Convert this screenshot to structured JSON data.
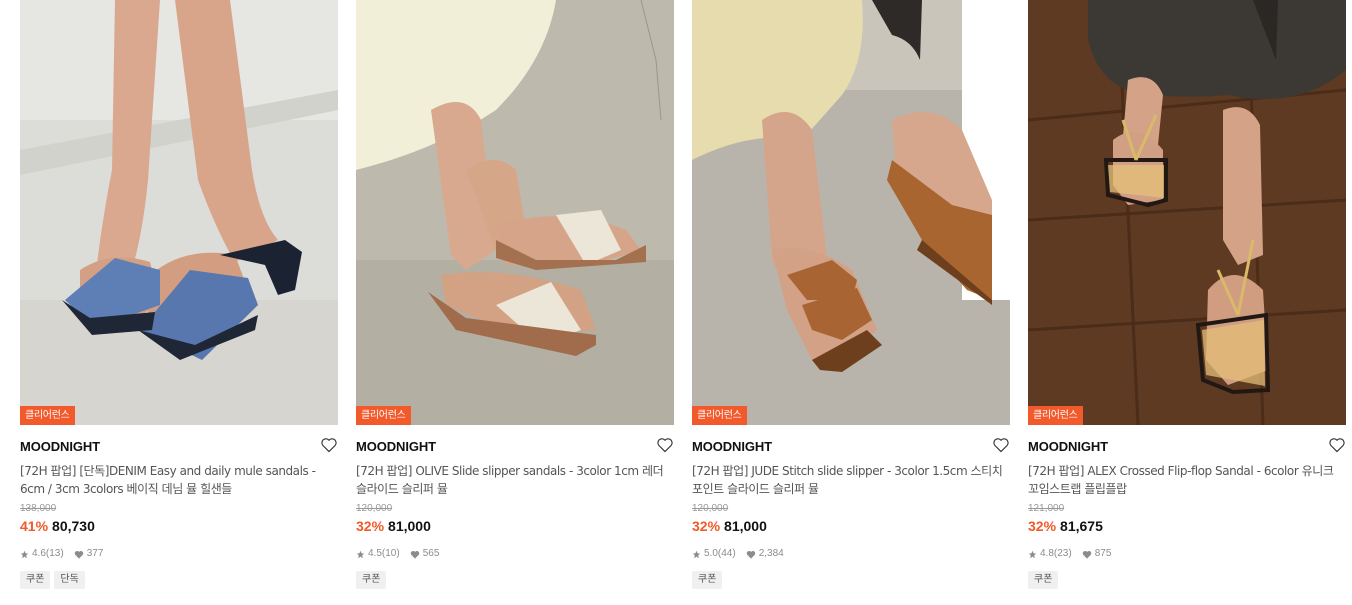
{
  "products": [
    {
      "badge": "클리어런스",
      "brand": "MOODNIGHT",
      "title": "[72H 팝업] [단독]DENIM Easy and daily mule sandals - 6cm / 3cm 3colors 베이직 데님 뮬 힐샌들",
      "original_price": "138,000",
      "discount": "41%",
      "price": "80,730",
      "rating": "4.6",
      "reviews": "(13)",
      "likes": "377",
      "tags": [
        "쿠폰",
        "단독"
      ],
      "image_desc": "denim-mule-heel-photo"
    },
    {
      "badge": "클리어런스",
      "brand": "MOODNIGHT",
      "title": "[72H 팝업] OLIVE Slide slipper sandals - 3color 1cm 레더 슬라이드 슬리퍼 뮬",
      "original_price": "120,000",
      "discount": "32%",
      "price": "81,000",
      "rating": "4.5",
      "reviews": "(10)",
      "likes": "565",
      "tags": [
        "쿠폰"
      ],
      "image_desc": "ivory-slide-photo"
    },
    {
      "badge": "클리어런스",
      "brand": "MOODNIGHT",
      "title": "[72H 팝업] JUDE Stitch slide slipper - 3color 1.5cm 스티치 포인트 슬라이드 슬리퍼 뮬",
      "original_price": "120,000",
      "discount": "32%",
      "price": "81,000",
      "rating": "5.0",
      "reviews": "(44)",
      "likes": "2,384",
      "tags": [
        "쿠폰"
      ],
      "image_desc": "brown-stitch-slide-photo"
    },
    {
      "badge": "클리어런스",
      "brand": "MOODNIGHT",
      "title": "[72H 팝업] ALEX Crossed Flip-flop Sandal - 6color 유니크 꼬임스트랩 플립플랍",
      "original_price": "121,000",
      "discount": "32%",
      "price": "81,675",
      "rating": "4.8",
      "reviews": "(23)",
      "likes": "875",
      "tags": [
        "쿠폰"
      ],
      "image_desc": "yellow-flipflop-photo"
    }
  ],
  "colors": {
    "accent": "#f2592b",
    "tag_bg": "#f0f0f0",
    "muted": "#999999"
  }
}
